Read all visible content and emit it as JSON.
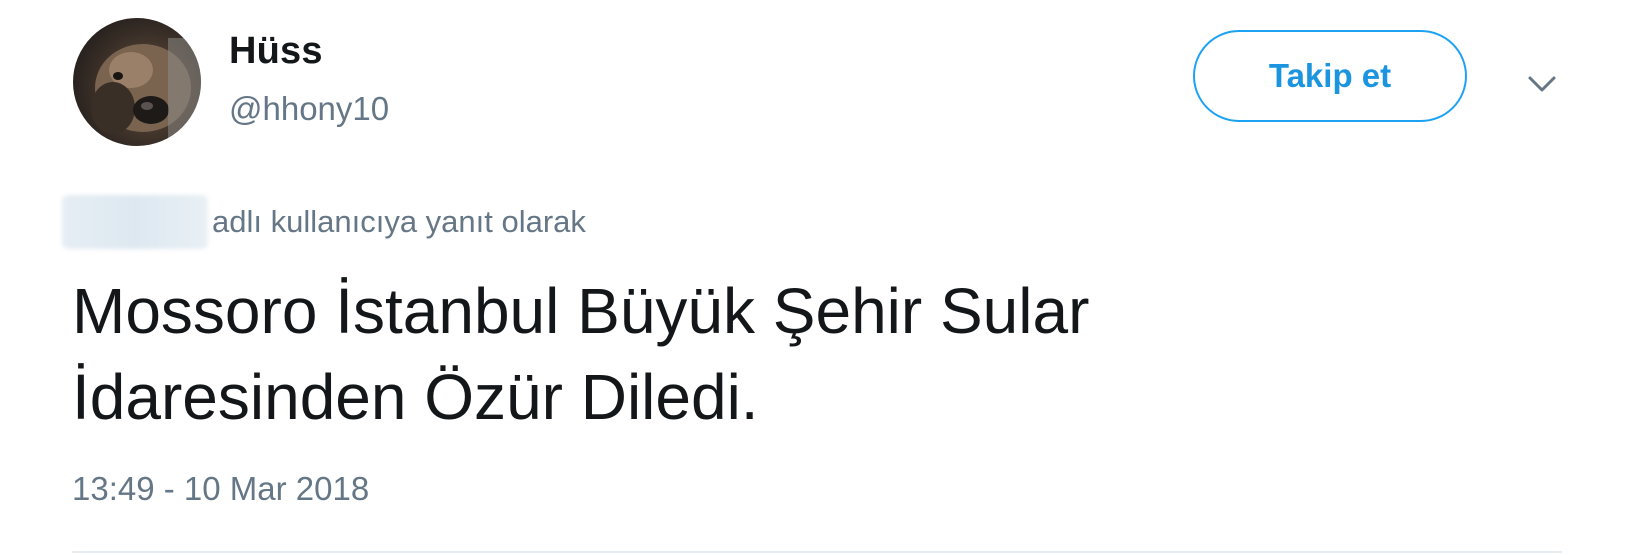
{
  "tweet": {
    "user": {
      "display_name": "Hüss",
      "handle": "@hhony10",
      "avatar_icon": "avatar-photo"
    },
    "follow_label": "Takip et",
    "menu_icon": "chevron-down-icon",
    "reply_context": "adlı kullanıcıya yanıt olarak",
    "text": "Mossoro İstanbul Büyük Şehir Sular\nİdaresinden Özür Diledi.",
    "timestamp": "13:49 - 10 Mar 2018"
  },
  "colors": {
    "accent": "#1da1f2",
    "secondary_text": "#657786",
    "primary_text": "#14171a"
  }
}
